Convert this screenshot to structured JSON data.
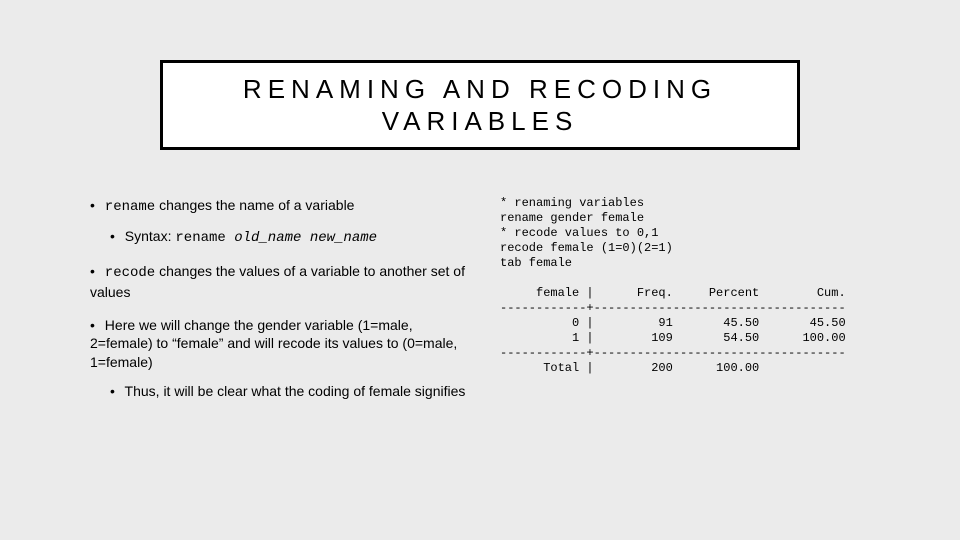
{
  "title": "RENAMING AND RECODING VARIABLES",
  "bullets": {
    "b1": {
      "code": "rename",
      "text": " changes the name of a variable",
      "sub": {
        "prefix": "Syntax: ",
        "cmd": "rename ",
        "arg1": "old_name",
        "sp": " ",
        "arg2": "new_name"
      }
    },
    "b2": {
      "code": "recode",
      "text": " changes the values of a variable to another set of values"
    },
    "b3": {
      "text": "Here we will change the gender variable (1=male, 2=female) to “female” and will recode its values to (0=male, 1=female)",
      "sub": "Thus, it will be clear what the coding of female signifies"
    }
  },
  "code": {
    "lines": [
      "* renaming variables",
      "rename gender female",
      "* recode values to 0,1",
      "recode female (1=0)(2=1)",
      "tab female"
    ],
    "table": {
      "header": "     female |      Freq.     Percent        Cum.",
      "sep": "------------+-----------------------------------",
      "r0": "          0 |         91       45.50       45.50",
      "r1": "          1 |        109       54.50      100.00",
      "total": "      Total |        200      100.00"
    }
  }
}
